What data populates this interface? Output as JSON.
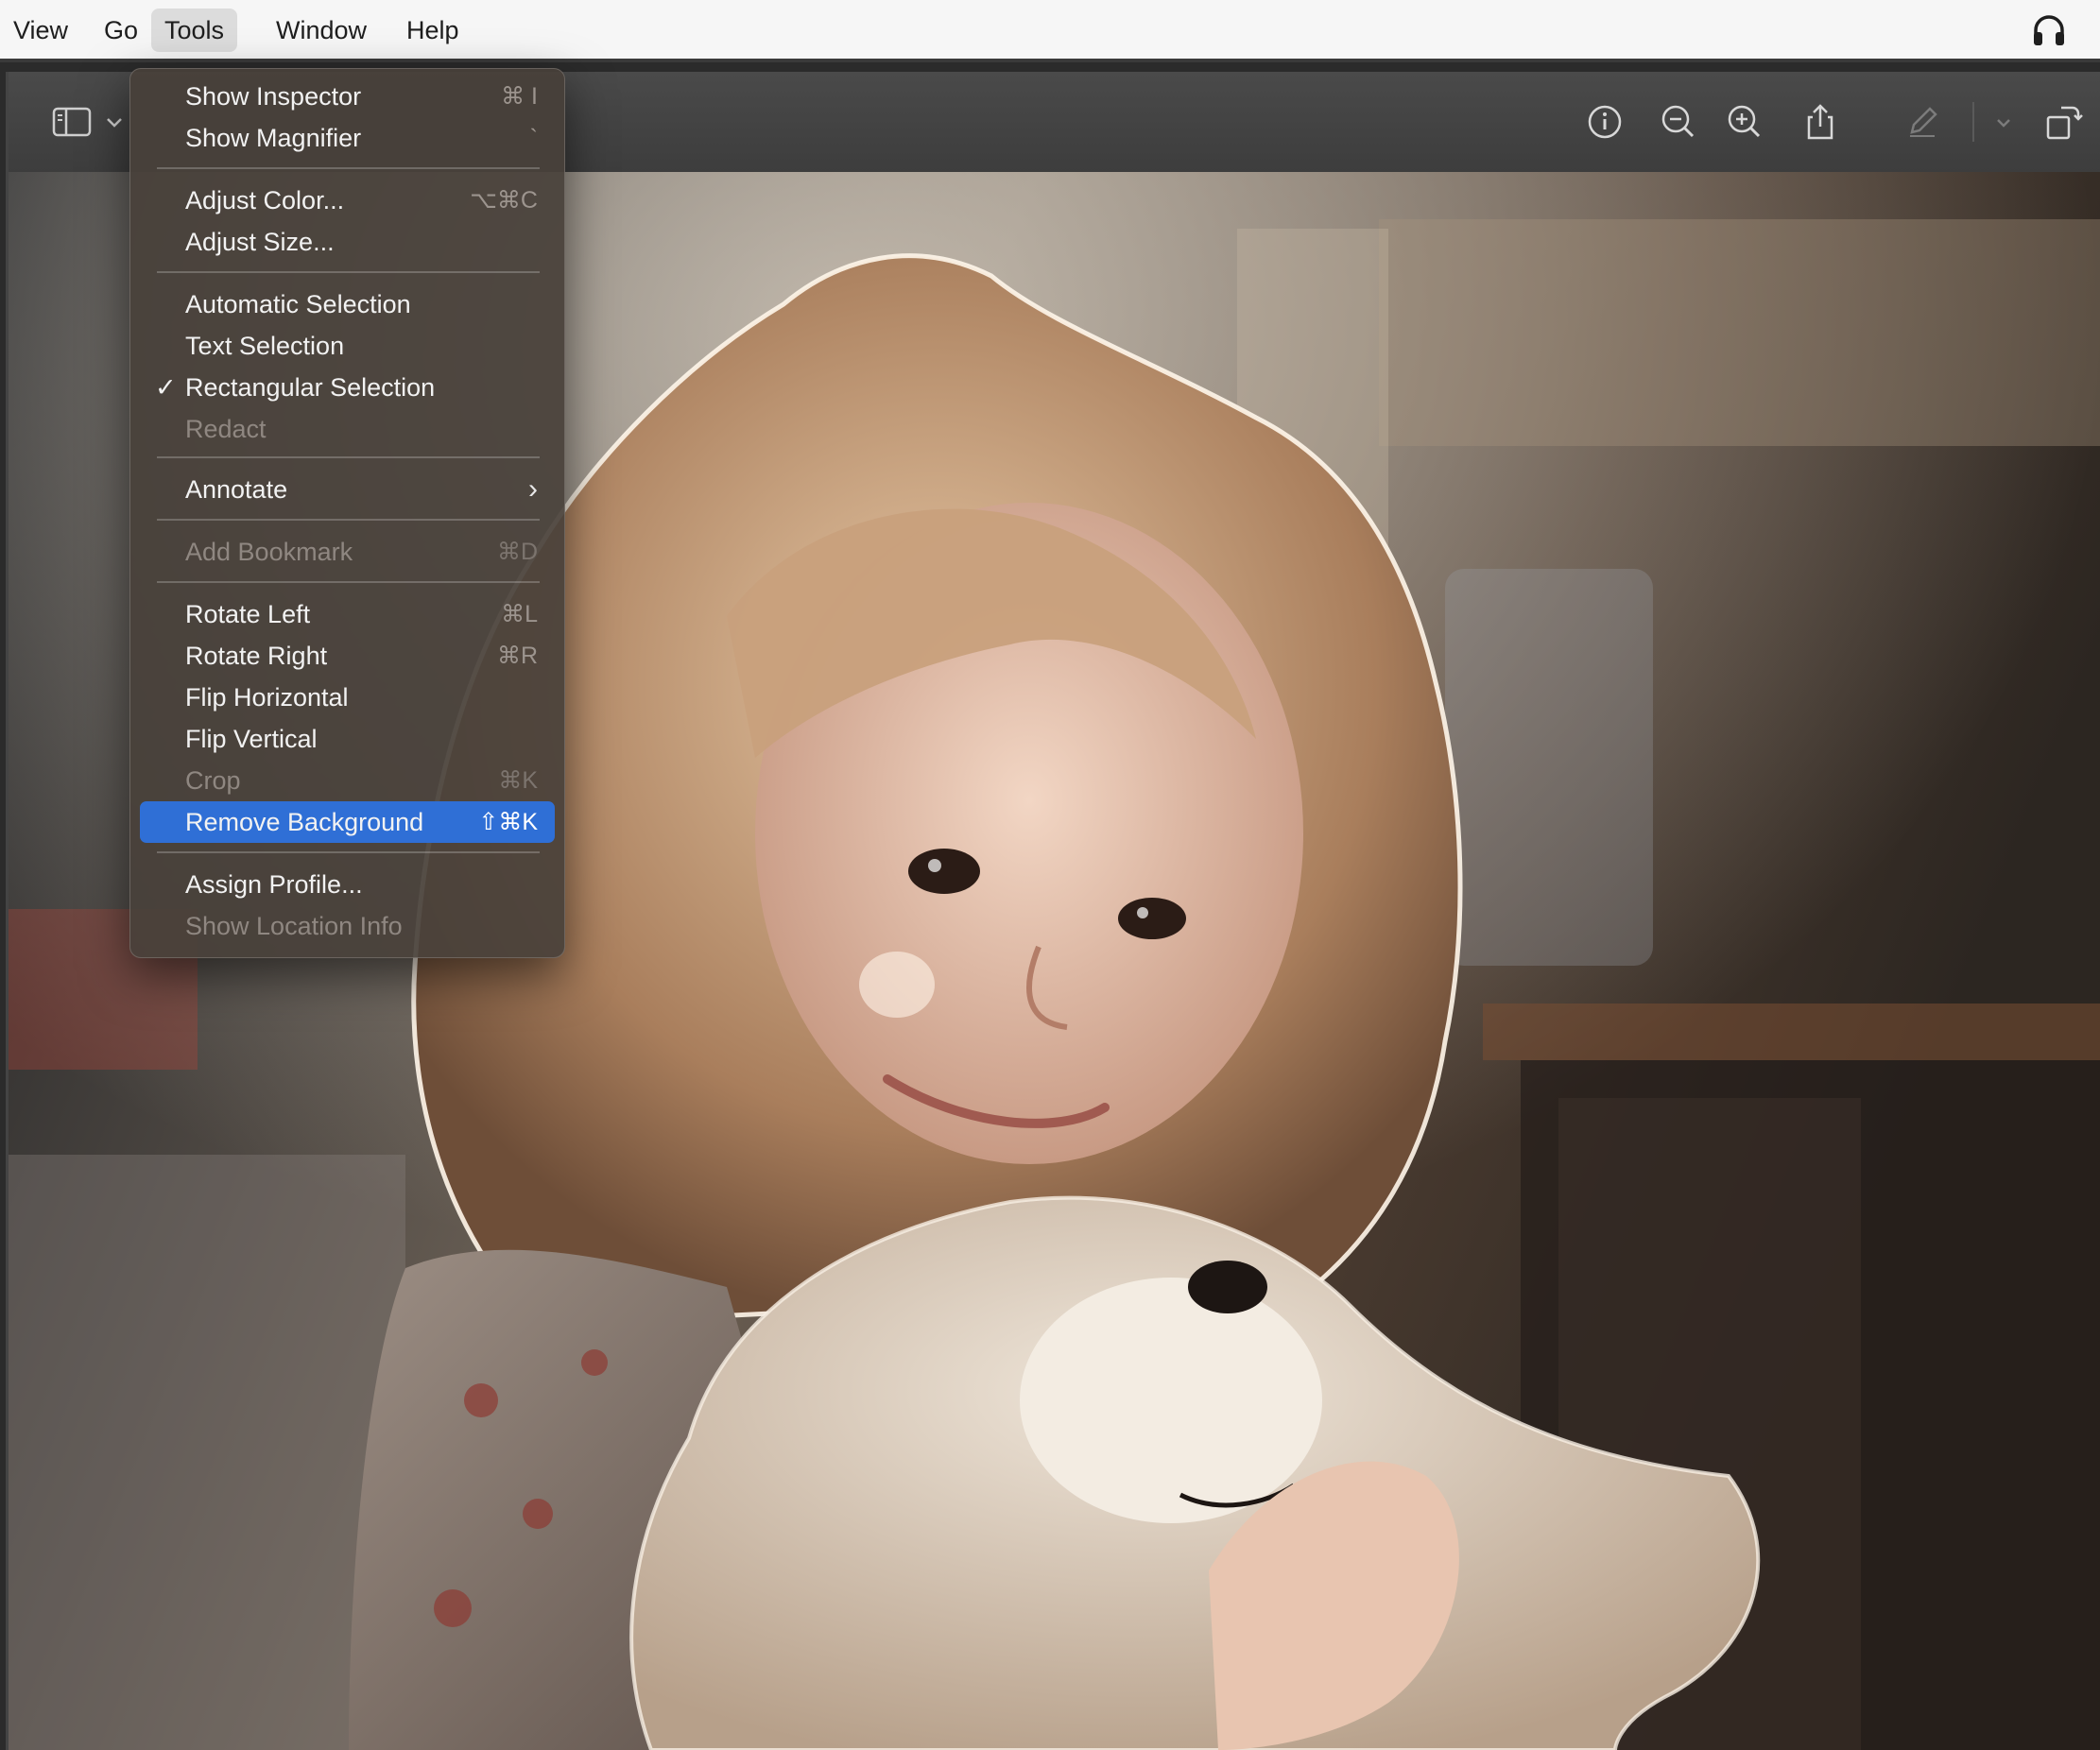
{
  "menubar": {
    "items": [
      {
        "label": "View"
      },
      {
        "label": "Go"
      },
      {
        "label": "Tools"
      },
      {
        "label": "Window"
      },
      {
        "label": "Help"
      }
    ],
    "right_icon": "headphones-icon"
  },
  "toolbar": {
    "left": [
      "sidebar-icon",
      "chevron-down-icon"
    ],
    "right": [
      "info-icon",
      "zoom-out-icon",
      "zoom-in-icon",
      "share-icon",
      "markup-pen-icon",
      "chevron-down-icon",
      "rotate-icon"
    ]
  },
  "tools_menu": {
    "items": [
      {
        "label": "Show Inspector",
        "shortcut": "⌘ I"
      },
      {
        "label": "Show Magnifier",
        "shortcut": "`"
      },
      {
        "label": "Adjust Color...",
        "shortcut": "⌥⌘C"
      },
      {
        "label": "Adjust Size..."
      },
      {
        "label": "Automatic Selection"
      },
      {
        "label": "Text Selection"
      },
      {
        "label": "Rectangular Selection",
        "checkmark": "✓"
      },
      {
        "label": "Redact"
      },
      {
        "label": "Annotate",
        "submenu_arrow": "›"
      },
      {
        "label": "Add Bookmark",
        "shortcut": "⌘D"
      },
      {
        "label": "Rotate Left",
        "shortcut": "⌘L"
      },
      {
        "label": "Rotate Right",
        "shortcut": "⌘R"
      },
      {
        "label": "Flip Horizontal"
      },
      {
        "label": "Flip Vertical"
      },
      {
        "label": "Crop",
        "shortcut": "⌘K"
      },
      {
        "label": "Remove Background",
        "shortcut": "⇧⌘K"
      },
      {
        "label": "Assign Profile..."
      },
      {
        "label": "Show Location Info"
      }
    ]
  },
  "colors": {
    "highlight": "#2f6fd6",
    "menu_bg": "#48403a",
    "menubar_bg": "#f6f6f6"
  }
}
